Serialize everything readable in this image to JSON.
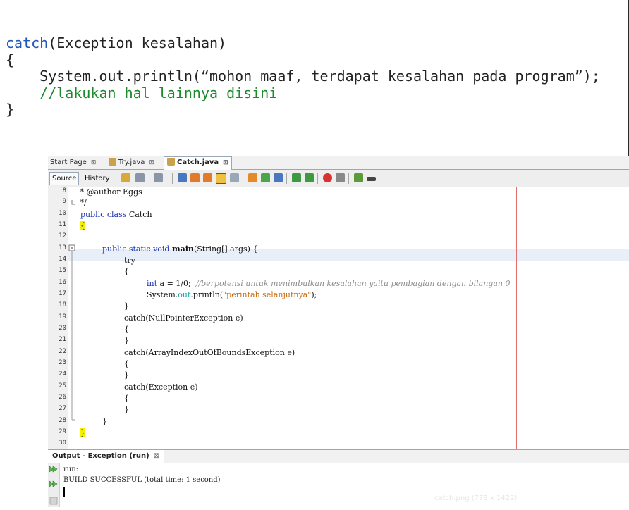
{
  "snippet": {
    "line1_kw": "catch",
    "line1_rest": "(Exception kesalahan)",
    "line2": "{",
    "line3": "    System.out.println(“mohon maaf, terdapat kesalahan pada program”);",
    "line4": "    //lakukan hal lainnya disini",
    "line5": "}"
  },
  "tabs": [
    {
      "label": "Start Page",
      "close": "⊠"
    },
    {
      "label": "Try.java",
      "close": "⊠"
    },
    {
      "label": "Catch.java",
      "close": "⊠"
    }
  ],
  "toolbar": {
    "source": "Source",
    "history": "History"
  },
  "line_numbers": [
    "8",
    "9",
    "10",
    "11",
    "12",
    "13",
    "14",
    "15",
    "16",
    "17",
    "18",
    "19",
    "20",
    "21",
    "22",
    "23",
    "24",
    "25",
    "26",
    "27",
    "28",
    "29",
    "30"
  ],
  "code": {
    "l8": " * @author Eggs",
    "l9": " */",
    "l10_kw": "public class",
    "l10_rest": " Catch",
    "l11": "{",
    "l13_kw": "public static void",
    "l13_fn": "main",
    "l13_rest": "(String[] args) {",
    "l14": "try",
    "l15": "{",
    "l16_kw": "int",
    "l16_code": " a = 1/0;  ",
    "l16_comment": "//berpotensi untuk menimbulkan kesalahan yaitu pembagian dengan bilangan 0",
    "l17_a": "System.",
    "l17_f": "out",
    "l17_b": ".println(",
    "l17_s": "\"perintah selanjutnya\"",
    "l17_c": ");",
    "l18": "}",
    "l19": "catch(NullPointerException e)",
    "l20": "{",
    "l21": "}",
    "l22": "catch(ArrayIndexOutOfBoundsException e)",
    "l23": "{",
    "l24": "}",
    "l25": "catch(Exception e)",
    "l26": "{",
    "l27": "}",
    "l28": "}",
    "l29": "}"
  },
  "output": {
    "tab_label": "Output - Exception (run)",
    "tab_close": "⊠",
    "line1": "run:",
    "line2": "BUILD SUCCESSFUL (total time: 1 second)"
  },
  "watermark": "catch.png (778 x 1422)",
  "colors": {
    "keyword": "#1a35b2",
    "string": "#c66a10",
    "comment": "#8d8d8d",
    "margin_line": "#e07070",
    "current_line": "#e9eff8"
  }
}
